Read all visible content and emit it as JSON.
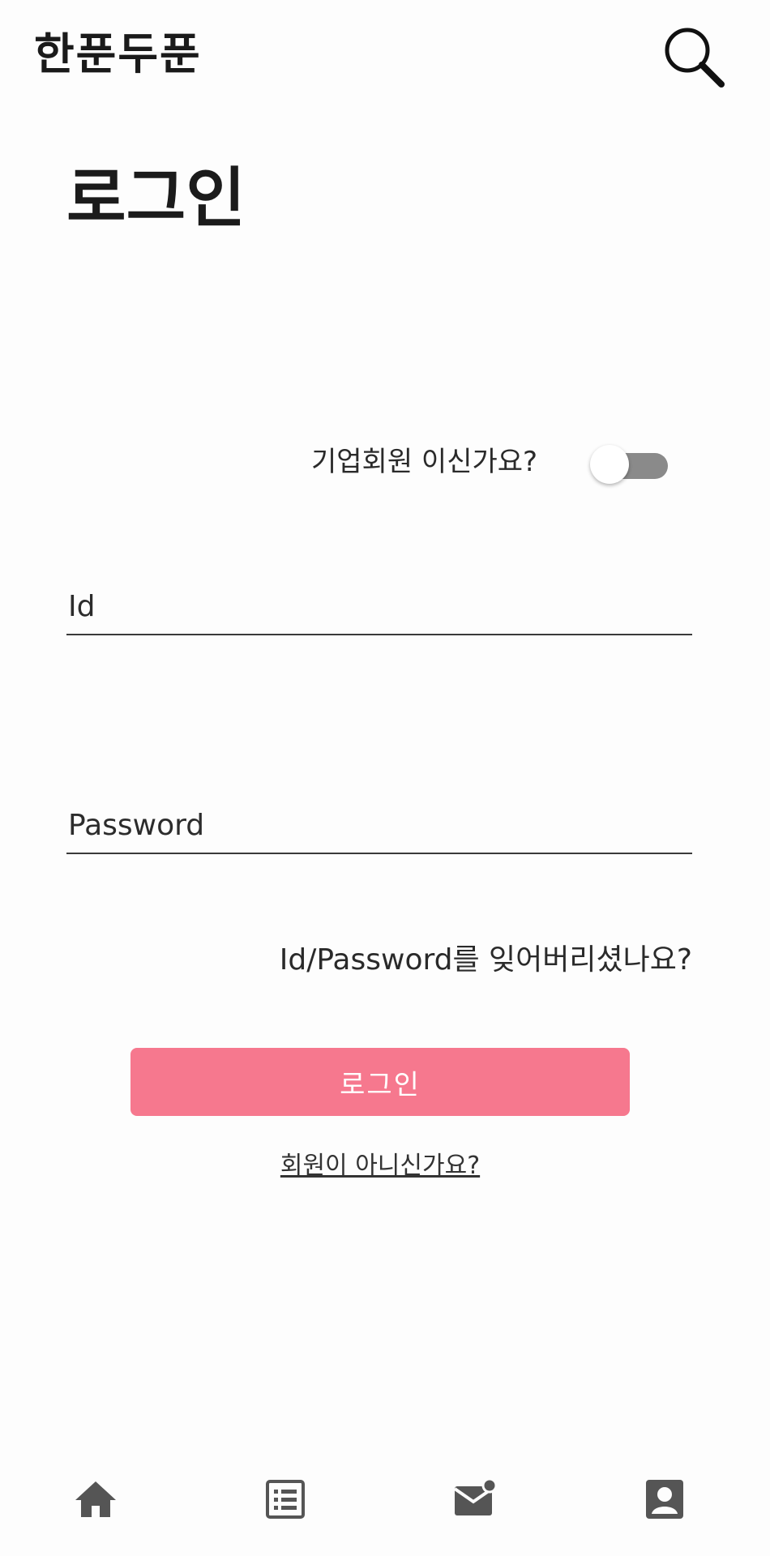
{
  "header": {
    "logo": "한푼두푼",
    "search_icon": "search-icon"
  },
  "page_title": "로그인",
  "corporate_toggle": {
    "label": "기업회원 이신가요?",
    "checked": false
  },
  "form": {
    "id_placeholder": "Id",
    "password_placeholder": "Password",
    "forgot_label": "Id/Password를 잊어버리셨나요?",
    "login_button": "로그인",
    "signup_link": "회원이 아니신가요?"
  },
  "bottom_nav": {
    "items": [
      {
        "icon": "home-icon"
      },
      {
        "icon": "list-icon"
      },
      {
        "icon": "mail-icon"
      },
      {
        "icon": "profile-icon"
      }
    ]
  },
  "colors": {
    "accent": "#f6788e",
    "nav_icon": "#555555",
    "toggle_track": "#8a8a8a"
  }
}
